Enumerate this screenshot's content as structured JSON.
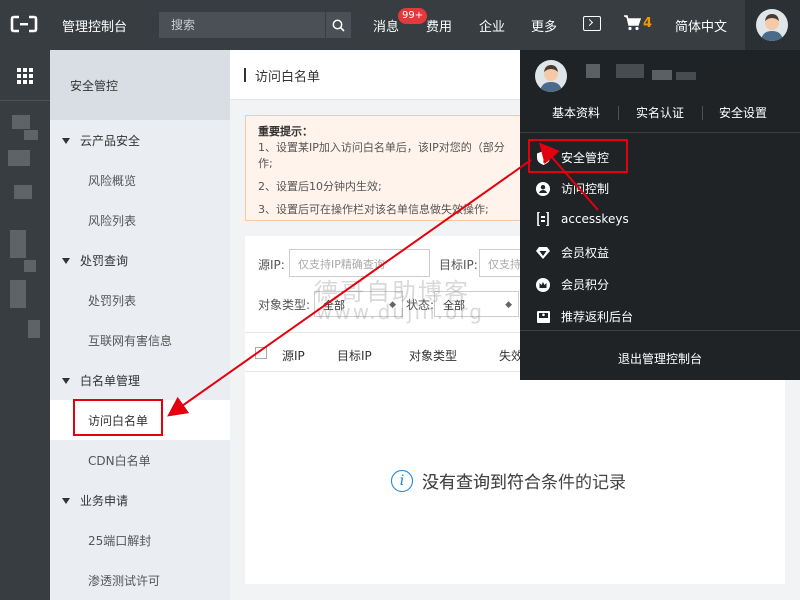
{
  "topbar": {
    "brand": "管理控制台",
    "search_placeholder": "搜索",
    "nav": {
      "messages": "消息",
      "messages_badge": "99+",
      "billing": "费用",
      "enterprise": "企业",
      "more": "更多",
      "language": "简体中文"
    },
    "cart_count": "4"
  },
  "sidebar": {
    "title": "安全管控",
    "groups": [
      {
        "label": "云产品安全",
        "items": [
          "风险概览",
          "风险列表"
        ]
      },
      {
        "label": "处罚查询",
        "items": [
          "处罚列表",
          "互联网有害信息"
        ]
      },
      {
        "label": "白名单管理",
        "items": [
          "访问白名单",
          "CDN白名单"
        ]
      },
      {
        "label": "业务申请",
        "items": [
          "25端口解封",
          "渗透测试许可"
        ]
      }
    ],
    "active_item": "访问白名单"
  },
  "main": {
    "title": "访问白名单",
    "notice": {
      "title": "重要提示：",
      "lines": [
        "1、设置某IP加入访问白名单后，该IP对您的（部分",
        "作;",
        "2、设置后10分钟内生效;",
        "3、设置后可在操作栏对该名单信息做失效操作;"
      ]
    },
    "filters": {
      "source_ip_label": "源IP:",
      "source_ip_placeholder": "仅支持IP精确查询",
      "target_ip_label": "目标IP:",
      "target_ip_placeholder": "仅支持",
      "object_type_label": "对象类型:",
      "object_type_value": "全部",
      "status_label": "状态:",
      "status_value": "全部"
    },
    "table_headers": [
      "源IP",
      "目标IP",
      "对象类型",
      "失效"
    ],
    "empty_text": "没有查询到符合条件的记录"
  },
  "watermark": {
    "line1": "德哥自助博客",
    "line2": "www.dujin.org"
  },
  "dropdown": {
    "links": [
      "基本资料",
      "实名认证",
      "安全设置"
    ],
    "items": [
      {
        "label": "安全管控",
        "icon": "shield-icon"
      },
      {
        "label": "访问控制",
        "icon": "user-icon"
      },
      {
        "label": "accesskeys",
        "icon": "key-icon"
      },
      {
        "label": "会员权益",
        "icon": "diamond-icon"
      },
      {
        "label": "会员积分",
        "icon": "crown-icon"
      },
      {
        "label": "推荐返利后台",
        "icon": "gift-icon"
      }
    ],
    "logout": "退出管理控制台"
  },
  "colors": {
    "topbar": "#373d41",
    "dropdown": "#1f2326",
    "annotation_red": "#e4000f",
    "badge": "#e4393c",
    "cart": "#f39800",
    "info": "#2a8ed7"
  }
}
